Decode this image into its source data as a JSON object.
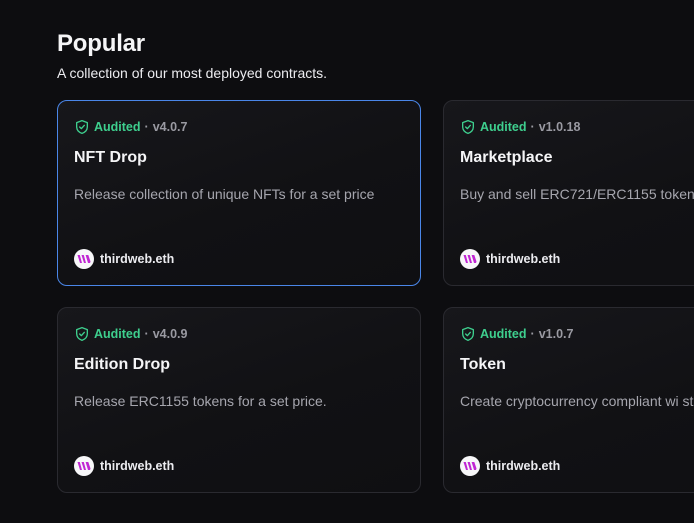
{
  "section": {
    "title": "Popular",
    "subtitle": "A collection of our most deployed contracts."
  },
  "colors": {
    "audited": "#3ecf8e",
    "selected_border": "#4a86e8",
    "publisher_brand": "#c026d3"
  },
  "cards": [
    {
      "audited_label": "Audited",
      "separator": "·",
      "version": "v4.0.7",
      "title": "NFT Drop",
      "description": "Release collection of unique NFTs for a set price",
      "publisher": "thirdweb.eth",
      "icon": "shield-check-icon",
      "selected": true
    },
    {
      "audited_label": "Audited",
      "separator": "·",
      "version": "v1.0.18",
      "title": "Marketplace",
      "description": "Buy and sell ERC721/ERC1155 token",
      "publisher": "thirdweb.eth",
      "icon": "shield-check-icon",
      "selected": false
    },
    {
      "audited_label": "Audited",
      "separator": "·",
      "version": "v4.0.9",
      "title": "Edition Drop",
      "description": "Release ERC1155 tokens for a set price.",
      "publisher": "thirdweb.eth",
      "icon": "shield-check-icon",
      "selected": false
    },
    {
      "audited_label": "Audited",
      "separator": "·",
      "version": "v1.0.7",
      "title": "Token",
      "description": "Create cryptocurrency compliant wi standard",
      "publisher": "thirdweb.eth",
      "icon": "shield-check-icon",
      "selected": false
    }
  ]
}
